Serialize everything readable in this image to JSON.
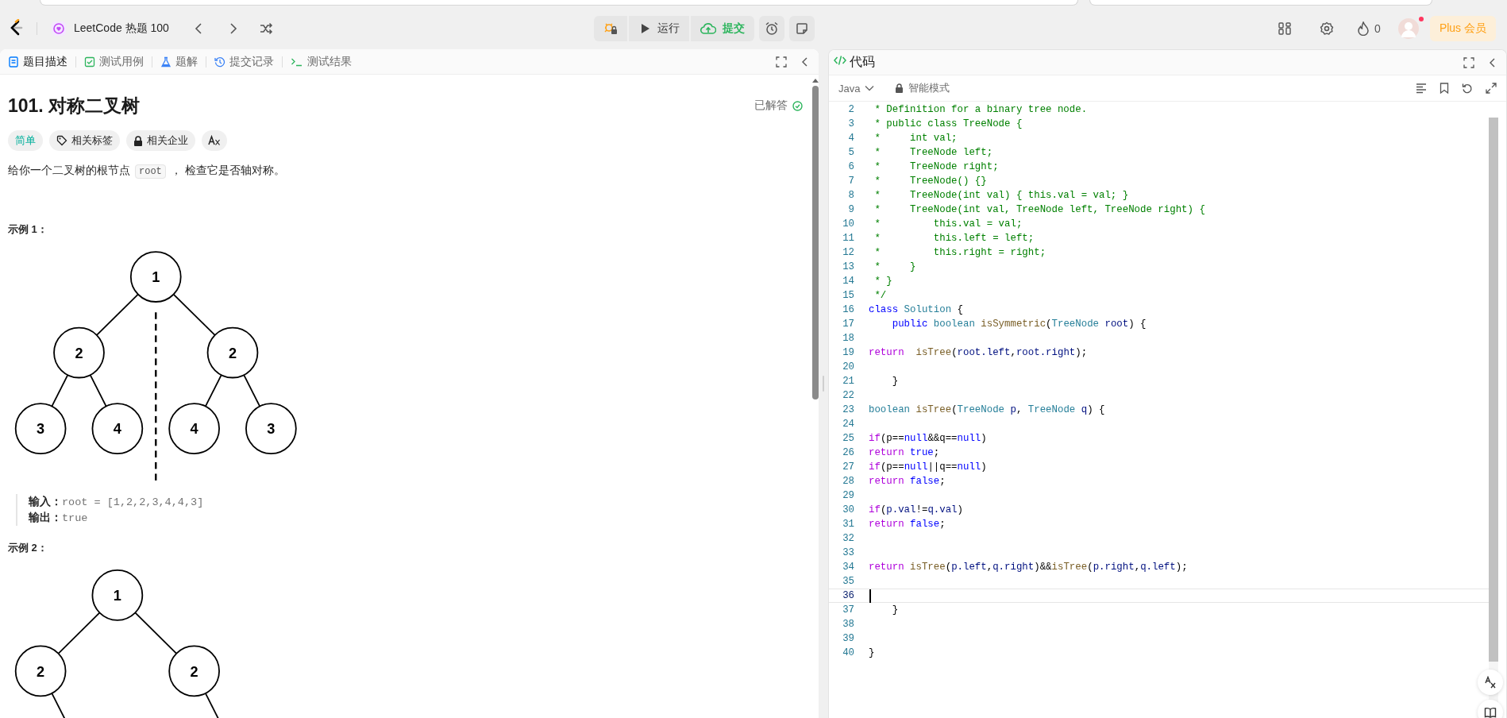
{
  "nav": {
    "title": "LeetCode 热题 100",
    "run": "运行",
    "submit": "提交",
    "streak": "0",
    "avatar_badge": true,
    "plus": "Plus 会员"
  },
  "problem_tabs": [
    {
      "label": "题目描述",
      "kind": "description",
      "selected": true
    },
    {
      "label": "测试用例",
      "kind": "testcase",
      "selected": false
    },
    {
      "label": "题解",
      "kind": "solution",
      "selected": false
    },
    {
      "label": "提交记录",
      "kind": "history",
      "selected": false
    },
    {
      "label": "测试结果",
      "kind": "result",
      "selected": false
    }
  ],
  "problem": {
    "title": "101. 对称二叉树",
    "status": "已解答",
    "tags": [
      {
        "label": "简单",
        "kind": "difficulty"
      },
      {
        "label": "相关标签",
        "kind": "tag"
      },
      {
        "label": "相关企业",
        "kind": "locked"
      },
      {
        "kind": "translate"
      }
    ],
    "description": {
      "before": "给你一个二叉树的根节点",
      "code": "root",
      "after": "， 检查它是否轴对称。"
    },
    "examples": [
      {
        "title": "示例 1：",
        "mirror_axis": true,
        "tree": {
          "value": "1",
          "children": [
            {
              "value": "2",
              "children": [
                {
                  "value": "3"
                },
                {
                  "value": "4"
                }
              ]
            },
            {
              "value": "2",
              "children": [
                {
                  "value": "4"
                },
                {
                  "value": "3"
                }
              ]
            }
          ]
        },
        "io": [
          {
            "label": "输入：",
            "value": "root = [1,2,2,3,4,4,3]"
          },
          {
            "label": "输出：",
            "value": "true"
          }
        ]
      },
      {
        "title": "示例 2：",
        "mirror_axis": false,
        "tree": {
          "value": "1",
          "children": [
            {
              "value": "2",
              "right_child_offscreen": true
            },
            {
              "value": "2",
              "right_child_offscreen": true
            }
          ]
        }
      }
    ]
  },
  "code_panel": {
    "title": "代码",
    "language": "Java",
    "mode": "智能模式",
    "lines": [
      {
        "number": "2",
        "current": false,
        "tokens": [
          {
            "text": " * Definition for a binary tree node.",
            "kind": "comment"
          }
        ]
      },
      {
        "number": "3",
        "current": false,
        "tokens": [
          {
            "text": " * public class TreeNode {",
            "kind": "comment"
          }
        ]
      },
      {
        "number": "4",
        "current": false,
        "tokens": [
          {
            "text": " *     int val;",
            "kind": "comment"
          }
        ]
      },
      {
        "number": "5",
        "current": false,
        "tokens": [
          {
            "text": " *     TreeNode left;",
            "kind": "comment"
          }
        ]
      },
      {
        "number": "6",
        "current": false,
        "tokens": [
          {
            "text": " *     TreeNode right;",
            "kind": "comment"
          }
        ]
      },
      {
        "number": "7",
        "current": false,
        "tokens": [
          {
            "text": " *     TreeNode() {}",
            "kind": "comment"
          }
        ]
      },
      {
        "number": "8",
        "current": false,
        "tokens": [
          {
            "text": " *     TreeNode(int val) { this.val = val; }",
            "kind": "comment"
          }
        ]
      },
      {
        "number": "9",
        "current": false,
        "tokens": [
          {
            "text": " *     TreeNode(int val, TreeNode left, TreeNode right) {",
            "kind": "comment"
          }
        ]
      },
      {
        "number": "10",
        "current": false,
        "tokens": [
          {
            "text": " *         this.val = val;",
            "kind": "comment"
          }
        ]
      },
      {
        "number": "11",
        "current": false,
        "tokens": [
          {
            "text": " *         this.left = left;",
            "kind": "comment"
          }
        ]
      },
      {
        "number": "12",
        "current": false,
        "tokens": [
          {
            "text": " *         this.right = right;",
            "kind": "comment"
          }
        ]
      },
      {
        "number": "13",
        "current": false,
        "tokens": [
          {
            "text": " *     }",
            "kind": "comment"
          }
        ]
      },
      {
        "number": "14",
        "current": false,
        "tokens": [
          {
            "text": " * }",
            "kind": "comment"
          }
        ]
      },
      {
        "number": "15",
        "current": false,
        "tokens": [
          {
            "text": " */",
            "kind": "comment"
          }
        ]
      },
      {
        "number": "16",
        "current": false,
        "tokens": [
          {
            "text": "class",
            "kind": "keyword"
          },
          {
            "text": " Solution",
            "kind": "type"
          },
          {
            "text": " {",
            "kind": "plain"
          }
        ]
      },
      {
        "number": "17",
        "current": false,
        "tokens": [
          {
            "text": "    public",
            "kind": "keyword"
          },
          {
            "text": " boolean",
            "kind": "type"
          },
          {
            "text": " isSymmetric",
            "kind": "function"
          },
          {
            "text": "(",
            "kind": "plain"
          },
          {
            "text": "TreeNode",
            "kind": "type"
          },
          {
            "text": " root",
            "kind": "variable"
          },
          {
            "text": ") {",
            "kind": "plain"
          }
        ]
      },
      {
        "number": "18",
        "current": false
      },
      {
        "number": "19",
        "current": false,
        "tokens": [
          {
            "text": "return",
            "kind": "control"
          },
          {
            "text": "  isTree",
            "kind": "function"
          },
          {
            "text": "(",
            "kind": "plain"
          },
          {
            "text": "root.left",
            "kind": "variable"
          },
          {
            "text": ",",
            "kind": "plain"
          },
          {
            "text": "root.right",
            "kind": "variable"
          },
          {
            "text": ");",
            "kind": "plain"
          }
        ]
      },
      {
        "number": "20",
        "current": false
      },
      {
        "number": "21",
        "current": false,
        "tokens": [
          {
            "text": "    }",
            "kind": "plain"
          }
        ]
      },
      {
        "number": "22",
        "current": false
      },
      {
        "number": "23",
        "current": false,
        "tokens": [
          {
            "text": "boolean",
            "kind": "type"
          },
          {
            "text": " isTree",
            "kind": "function"
          },
          {
            "text": "(",
            "kind": "plain"
          },
          {
            "text": "TreeNode",
            "kind": "type"
          },
          {
            "text": " p",
            "kind": "variable"
          },
          {
            "text": ", ",
            "kind": "plain"
          },
          {
            "text": "TreeNode",
            "kind": "type"
          },
          {
            "text": " q",
            "kind": "variable"
          },
          {
            "text": ") {",
            "kind": "plain"
          }
        ]
      },
      {
        "number": "24",
        "current": false
      },
      {
        "number": "25",
        "current": false,
        "tokens": [
          {
            "text": "if",
            "kind": "control"
          },
          {
            "text": "(p==",
            "kind": "plain"
          },
          {
            "text": "null",
            "kind": "keyword"
          },
          {
            "text": "&&q==",
            "kind": "plain"
          },
          {
            "text": "null",
            "kind": "keyword"
          },
          {
            "text": ")",
            "kind": "plain"
          }
        ]
      },
      {
        "number": "26",
        "current": false,
        "tokens": [
          {
            "text": "return",
            "kind": "control"
          },
          {
            "text": " true",
            "kind": "keyword"
          },
          {
            "text": ";",
            "kind": "plain"
          }
        ]
      },
      {
        "number": "27",
        "current": false,
        "tokens": [
          {
            "text": "if",
            "kind": "control"
          },
          {
            "text": "(p==",
            "kind": "plain"
          },
          {
            "text": "null",
            "kind": "keyword"
          },
          {
            "text": "||q==",
            "kind": "plain"
          },
          {
            "text": "null",
            "kind": "keyword"
          },
          {
            "text": ")",
            "kind": "plain"
          }
        ]
      },
      {
        "number": "28",
        "current": false,
        "tokens": [
          {
            "text": "return",
            "kind": "control"
          },
          {
            "text": " false",
            "kind": "keyword"
          },
          {
            "text": ";",
            "kind": "plain"
          }
        ]
      },
      {
        "number": "29",
        "current": false
      },
      {
        "number": "30",
        "current": false,
        "tokens": [
          {
            "text": "if",
            "kind": "control"
          },
          {
            "text": "(",
            "kind": "plain"
          },
          {
            "text": "p.val",
            "kind": "variable"
          },
          {
            "text": "!=",
            "kind": "plain"
          },
          {
            "text": "q.val",
            "kind": "variable"
          },
          {
            "text": ")",
            "kind": "plain"
          }
        ]
      },
      {
        "number": "31",
        "current": false,
        "tokens": [
          {
            "text": "return",
            "kind": "control"
          },
          {
            "text": " false",
            "kind": "keyword"
          },
          {
            "text": ";",
            "kind": "plain"
          }
        ]
      },
      {
        "number": "32",
        "current": false
      },
      {
        "number": "33",
        "current": false
      },
      {
        "number": "34",
        "current": false,
        "tokens": [
          {
            "text": "return",
            "kind": "control"
          },
          {
            "text": " isTree",
            "kind": "function"
          },
          {
            "text": "(",
            "kind": "plain"
          },
          {
            "text": "p.left",
            "kind": "variable"
          },
          {
            "text": ",",
            "kind": "plain"
          },
          {
            "text": "q.right",
            "kind": "variable"
          },
          {
            "text": ")&&",
            "kind": "plain"
          },
          {
            "text": "isTree",
            "kind": "function"
          },
          {
            "text": "(",
            "kind": "plain"
          },
          {
            "text": "p.right",
            "kind": "variable"
          },
          {
            "text": ",",
            "kind": "plain"
          },
          {
            "text": "q.left",
            "kind": "variable"
          },
          {
            "text": ");",
            "kind": "plain"
          }
        ]
      },
      {
        "number": "35",
        "current": false
      },
      {
        "number": "36",
        "current": true
      },
      {
        "number": "37",
        "current": false,
        "tokens": [
          {
            "text": "    }",
            "kind": "plain"
          }
        ]
      },
      {
        "number": "38",
        "current": false
      },
      {
        "number": "39",
        "current": false
      },
      {
        "number": "40",
        "current": false,
        "tokens": [
          {
            "text": "}",
            "kind": "plain"
          }
        ]
      }
    ]
  }
}
